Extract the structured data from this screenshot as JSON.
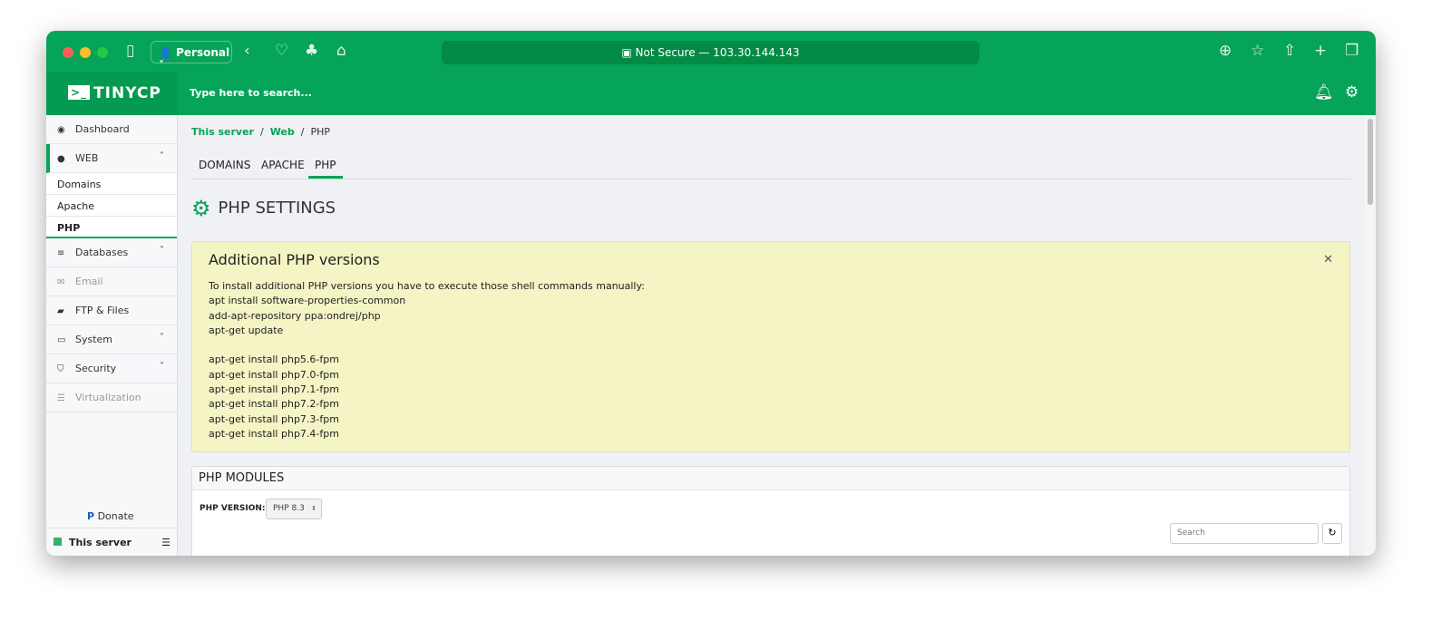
{
  "browser": {
    "profile": "Personal",
    "url": "Not Secure — 103.30.144.143"
  },
  "header": {
    "logo": "TINYCP",
    "search_placeholder": "Type here to search..."
  },
  "sidebar": {
    "items": [
      {
        "label": "Dashboard",
        "icon": "dashboard-icon"
      },
      {
        "label": "WEB",
        "icon": "globe-icon"
      },
      {
        "label": "Databases",
        "icon": "database-icon"
      },
      {
        "label": "Email",
        "icon": "envelope-icon"
      },
      {
        "label": "FTP & Files",
        "icon": "folder-icon"
      },
      {
        "label": "System",
        "icon": "drive-icon"
      },
      {
        "label": "Security",
        "icon": "shield-icon"
      },
      {
        "label": "Virtualization",
        "icon": "server-icon"
      }
    ],
    "web_sub": [
      "Domains",
      "Apache",
      "PHP"
    ],
    "donate": "Donate",
    "server": "This server"
  },
  "breadcrumb": [
    "This server",
    "Web",
    "PHP"
  ],
  "tabs": [
    "DOMAINS",
    "APACHE",
    "PHP"
  ],
  "page_title": "PHP SETTINGS",
  "alert": {
    "title": "Additional PHP versions",
    "lines": [
      "To install additional PHP versions you have to execute those shell commands manually:",
      "apt install software-properties-common",
      "add-apt-repository ppa:ondrej/php",
      "apt-get update",
      "",
      "apt-get install php5.6-fpm",
      "apt-get install php7.0-fpm",
      "apt-get install php7.1-fpm",
      "apt-get install php7.2-fpm",
      "apt-get install php7.3-fpm",
      "apt-get install php7.4-fpm"
    ]
  },
  "modules": {
    "title": "PHP MODULES",
    "version_label": "PHP VERSION:",
    "version": "PHP 8.3",
    "search_placeholder": "Search"
  },
  "colors": {
    "accent": "#05a458",
    "alert_bg": "#f4f4c5"
  }
}
